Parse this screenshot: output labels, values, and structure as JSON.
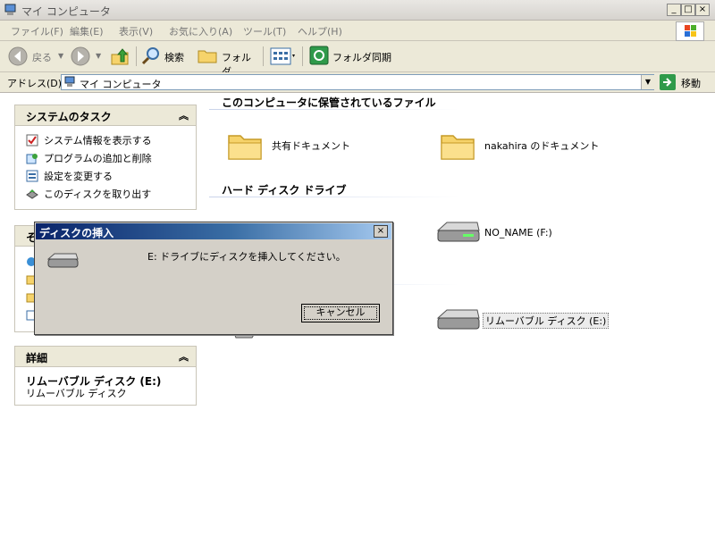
{
  "window": {
    "title": "マイ コンピュータ",
    "min": "_",
    "max": "□",
    "close": "×"
  },
  "menu": [
    "ファイル(F)",
    "編集(E)",
    "表示(V)",
    "お気に入り(A)",
    "ツール(T)",
    "ヘルプ(H)"
  ],
  "toolbar": {
    "back": "戻る",
    "search": "検索",
    "folders": "フォルダ",
    "sync": "フォルダ同期"
  },
  "address": {
    "label": "アドレス(D)",
    "value": "マイ コンピュータ",
    "go": "移動"
  },
  "system_tasks": {
    "title": "システムのタスク",
    "toggle": "«",
    "items": [
      "システム情報を表示する",
      "プログラムの追加と削除",
      "設定を変更する",
      "このディスクを取り出す"
    ]
  },
  "other_places": {
    "title_initial": "そ"
  },
  "details": {
    "title": "詳細",
    "toggle": "«",
    "name": "リムーバブル ディスク (E:)",
    "type": "リムーバブル ディスク"
  },
  "sections": {
    "stored_files": "このコンピュータに保管されているファイル",
    "hard_disks": "ハード ディスク ドライブ"
  },
  "items": {
    "shared_docs": "共有ドキュメント",
    "user_docs": "nakahira のドキュメント",
    "no_name": "NO_NAME (F:)",
    "removable": "リムーバブル ディスク (E:)"
  },
  "dialog": {
    "title": "ディスクの挿入",
    "message": "E: ドライブにディスクを挿入してください。",
    "cancel": "キャンセル",
    "close": "×"
  },
  "colors": {
    "dialog_title_start": "#0a246a",
    "dialog_title_end": "#a6caf0",
    "chrome": "#ece9d8"
  }
}
